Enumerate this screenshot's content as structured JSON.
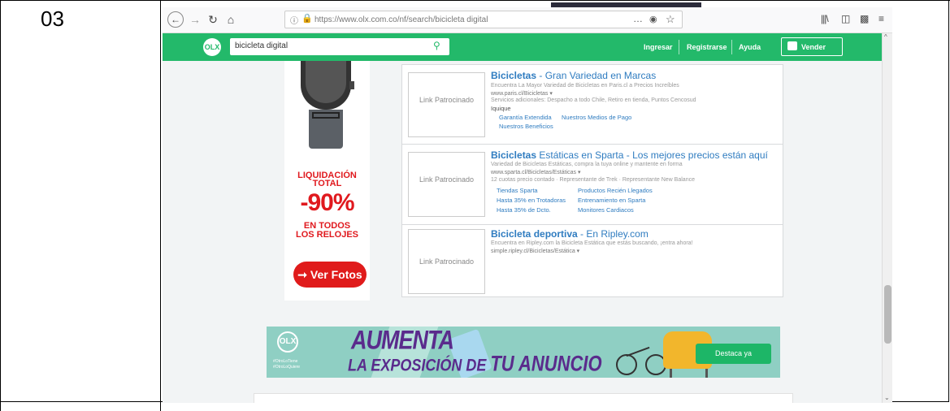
{
  "step_label": "03",
  "browser": {
    "url": "https://www.olx.com.co/nf/search/bicicleta digital",
    "url_menu_dots": "…",
    "icons": [
      "back-icon",
      "forward-icon",
      "reload-icon",
      "home-icon",
      "info-icon",
      "lock-icon",
      "pocket-icon",
      "star-icon",
      "library-icon",
      "sidebar-icon",
      "screenshot-icon",
      "menu-icon"
    ]
  },
  "olx": {
    "logo_text": "OLX",
    "search_value": "bicicleta digital",
    "nav": {
      "login": "Ingresar",
      "register": "Registrarse",
      "help": "Ayuda",
      "sell": "Vender"
    },
    "brand_color": "#23b96a"
  },
  "watch_ad": {
    "line1": "LIQUIDACIÓN",
    "line2": "TOTAL",
    "discount": "-90%",
    "line3": "EN TODOS",
    "line4": "LOS RELOJES",
    "button": "➞ Ver Fotos"
  },
  "sponsored": [
    {
      "thumb": "Link Patrocinado",
      "title_bold": "Bicicletas",
      "title_rest": " - Gran Variedad en Marcas",
      "desc": "Encuentra La Mayor Variedad de Bicicletas en Paris.cl a Precios Increíbles",
      "url": "www.paris.cl/Bicicletas ▾",
      "ext": "Servicios adicionales: Despacho a todo Chile, Retiro en tienda, Puntos Cencosud",
      "loc": "Iquique",
      "sitelinks": [
        "Garantía Extendida",
        "Nuestros Medios de Pago",
        "Nuestros Beneficios"
      ]
    },
    {
      "thumb": "Link Patrocinado",
      "title_bold": "Bicicletas",
      "title_rest": " Estáticas en Sparta - Los mejores precios están aquí",
      "desc": "Variedad de Bicicletas Estáticas, compra la tuya online y mantente en forma",
      "url": "www.sparta.cl/Bicicletas/Estáticas ▾",
      "ext": "12 cuotas precio contado · Representante de Trek · Representante New Balance",
      "sitelinks": [
        "Tiendas Sparta",
        "Productos Recién Llegados",
        "Hasta 35% en Trotadoras",
        "Entrenamiento en Sparta",
        "Hasta 35% de Dcto.",
        "Monitores Cardiacos"
      ]
    },
    {
      "thumb": "Link Patrocinado",
      "title_bold": "Bicicleta deportiva",
      "title_rest": " - En Ripley.com",
      "desc": "Encuentra en Ripley.com la Bicicleta Estática que estás buscando, ¡entra ahora!",
      "url": "simple.ripley.cl/Bicicletas/Estática ▾"
    }
  ],
  "banner": {
    "logo_text": "OLX",
    "tag1": "#OtroLoTiene",
    "tag2": "#OtroLoQuiere",
    "title_top": "AUMENTA",
    "title_bottom_a": "LA EXPOSICIÓN DE ",
    "title_bottom_b": "TU ANUNCIO",
    "button": "Destaca ya"
  }
}
